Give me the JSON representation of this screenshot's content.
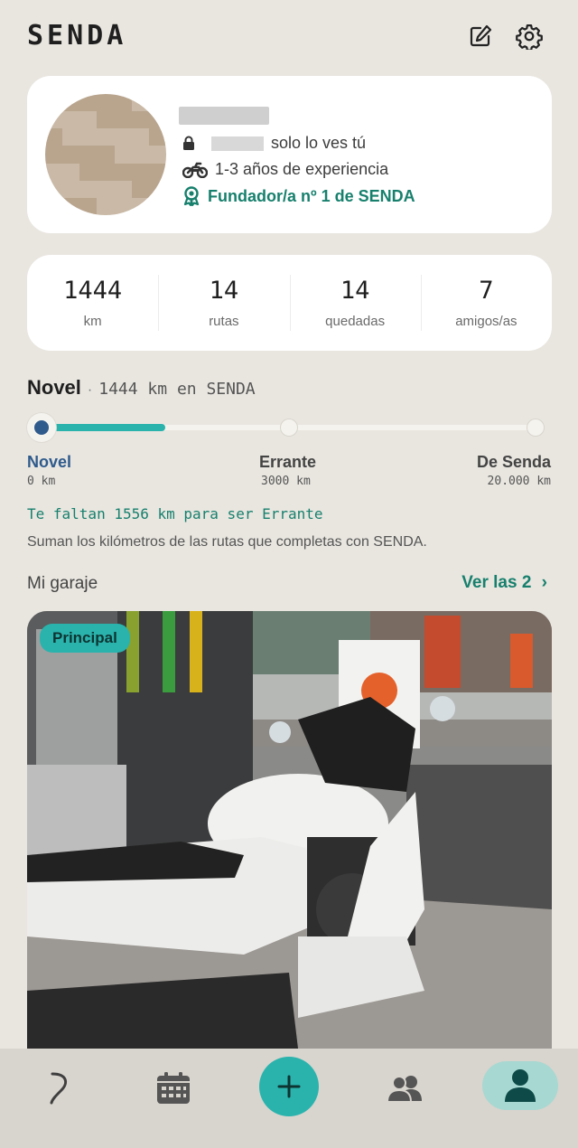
{
  "app": {
    "logo": "SENDA"
  },
  "header": {
    "edit_icon": "edit-icon",
    "settings_icon": "gear-icon"
  },
  "profile": {
    "privacy_text": "solo lo ves tú",
    "experience": "1-3 años de experiencia",
    "founder": "Fundador/a nº 1 de SENDA"
  },
  "stats": [
    {
      "value": "1444",
      "label": "km"
    },
    {
      "value": "14",
      "label": "rutas"
    },
    {
      "value": "14",
      "label": "quedadas"
    },
    {
      "value": "7",
      "label": "amigos/as"
    }
  ],
  "level": {
    "name": "Novel",
    "separator": "·",
    "summary": "1444 km en SENDA",
    "progress_fraction": 0.48,
    "steps": [
      {
        "name": "Novel",
        "km": "0 km"
      },
      {
        "name": "Errante",
        "km": "3000 km"
      },
      {
        "name": "De Senda",
        "km": "20.000 km"
      }
    ],
    "remaining": "Te faltan 1556 km para ser Errante",
    "note": "Suman los kilómetros de las rutas que completas con SENDA."
  },
  "garage": {
    "title": "Mi garaje",
    "link": "Ver las 2",
    "badge": "Principal"
  },
  "colors": {
    "accent": "#2ab3ad",
    "accent_text": "#17806d",
    "level_blue": "#2e5a8c",
    "background": "#e9e6e0"
  },
  "nav": [
    "routes-icon",
    "calendar-icon",
    "add-icon",
    "friends-icon",
    "profile-icon"
  ]
}
